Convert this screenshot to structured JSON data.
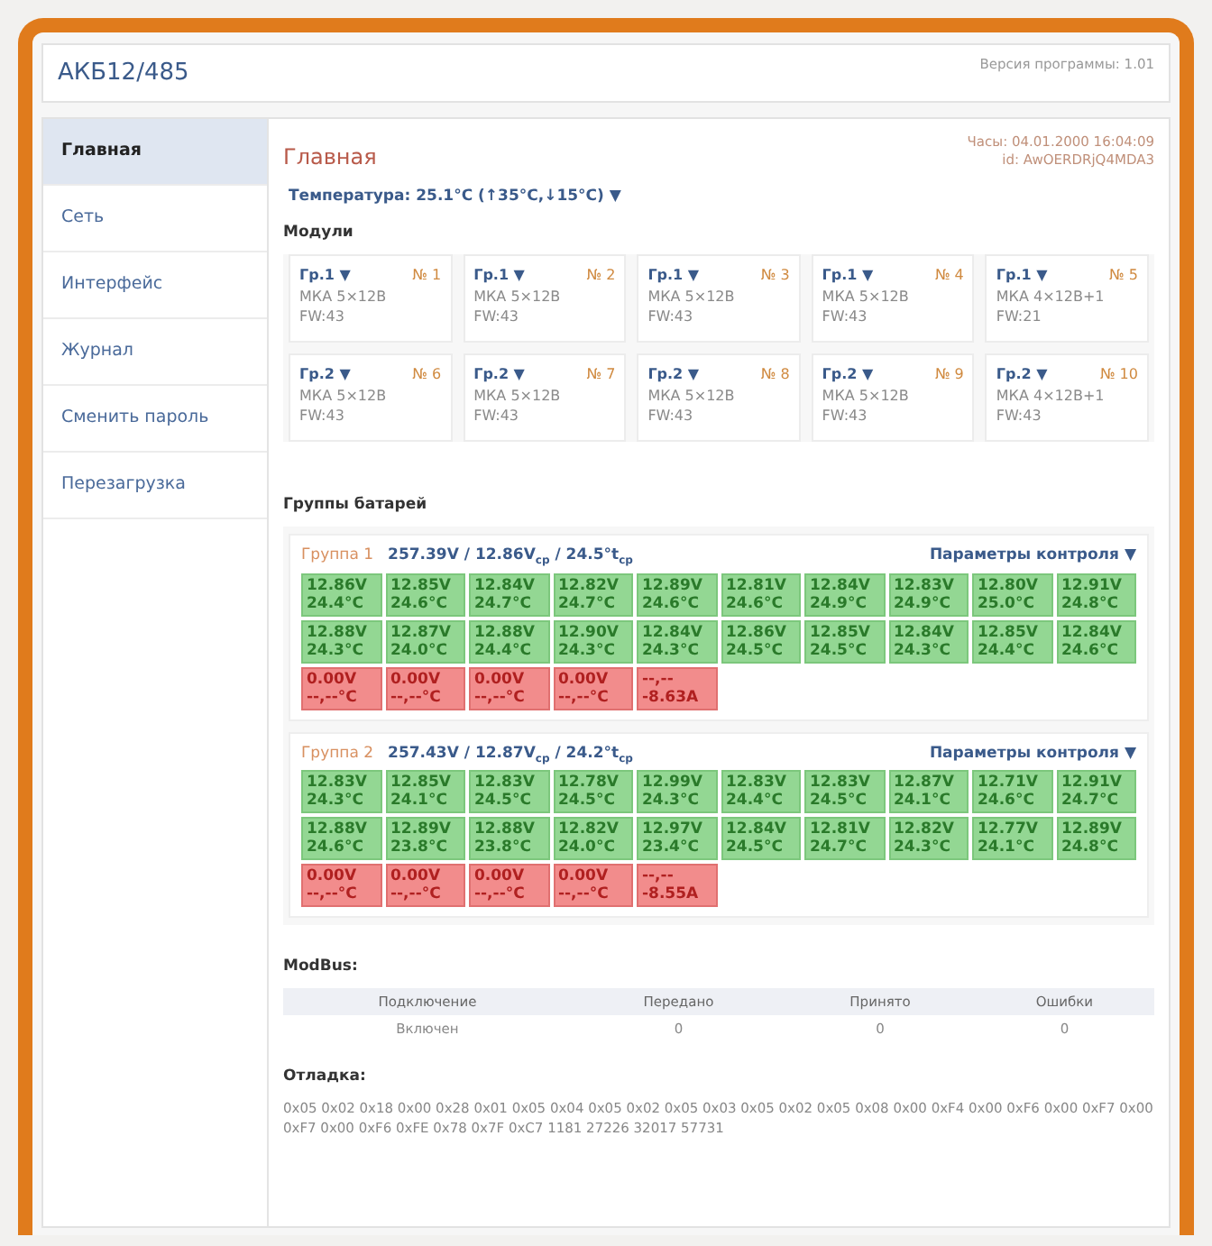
{
  "header": {
    "title": "АКБ12/485",
    "version": "Версия программы: 1.01"
  },
  "sidebar": {
    "items": [
      {
        "label": "Главная",
        "selected": true
      },
      {
        "label": "Сеть",
        "selected": false
      },
      {
        "label": "Интерфейс",
        "selected": false
      },
      {
        "label": "Журнал",
        "selected": false
      },
      {
        "label": "Сменить пароль",
        "selected": false
      },
      {
        "label": "Перезагрузка",
        "selected": false
      }
    ]
  },
  "main": {
    "title": "Главная",
    "clock": "Часы: 04.01.2000 16:04:09",
    "id": "id: AwOERDRjQ4MDA3",
    "temperature": "Температура: 25.1°C (↑35°C,↓15°C) ▼",
    "modules_title": "Модули",
    "modules": [
      {
        "group": "Гр.1 ▼",
        "number": "№ 1",
        "type": "МКА 5×12В",
        "fw": "FW:43"
      },
      {
        "group": "Гр.1 ▼",
        "number": "№ 2",
        "type": "МКА 5×12В",
        "fw": "FW:43"
      },
      {
        "group": "Гр.1 ▼",
        "number": "№ 3",
        "type": "МКА 5×12В",
        "fw": "FW:43"
      },
      {
        "group": "Гр.1 ▼",
        "number": "№ 4",
        "type": "МКА 5×12В",
        "fw": "FW:43"
      },
      {
        "group": "Гр.1 ▼",
        "number": "№ 5",
        "type": "МКА 4×12В+1",
        "fw": "FW:21"
      },
      {
        "group": "Гр.2 ▼",
        "number": "№ 6",
        "type": "МКА 5×12В",
        "fw": "FW:43"
      },
      {
        "group": "Гр.2 ▼",
        "number": "№ 7",
        "type": "МКА 5×12В",
        "fw": "FW:43"
      },
      {
        "group": "Гр.2 ▼",
        "number": "№ 8",
        "type": "МКА 5×12В",
        "fw": "FW:43"
      },
      {
        "group": "Гр.2 ▼",
        "number": "№ 9",
        "type": "МКА 5×12В",
        "fw": "FW:43"
      },
      {
        "group": "Гр.2 ▼",
        "number": "№ 10",
        "type": "МКА 4×12В+1",
        "fw": "FW:43"
      }
    ],
    "groups_title": "Группы батарей",
    "groups": [
      {
        "name": "Группа 1",
        "summary": "257.39V / 12.86V$_{ср}$ / 24.5°t$_{ср}$",
        "control": "Параметры контроля ▼",
        "cells": [
          {
            "kind": "ok",
            "top": "12.86V",
            "bottom": "24.4°C"
          },
          {
            "kind": "ok",
            "top": "12.85V",
            "bottom": "24.6°C"
          },
          {
            "kind": "ok",
            "top": "12.84V",
            "bottom": "24.7°C"
          },
          {
            "kind": "ok",
            "top": "12.82V",
            "bottom": "24.7°C"
          },
          {
            "kind": "ok",
            "top": "12.89V",
            "bottom": "24.6°C"
          },
          {
            "kind": "ok",
            "top": "12.81V",
            "bottom": "24.6°C"
          },
          {
            "kind": "ok",
            "top": "12.84V",
            "bottom": "24.9°C"
          },
          {
            "kind": "ok",
            "top": "12.83V",
            "bottom": "24.9°C"
          },
          {
            "kind": "ok",
            "top": "12.80V",
            "bottom": "25.0°C"
          },
          {
            "kind": "ok",
            "top": "12.91V",
            "bottom": "24.8°C"
          },
          {
            "kind": "ok",
            "top": "12.88V",
            "bottom": "24.3°C"
          },
          {
            "kind": "ok",
            "top": "12.87V",
            "bottom": "24.0°C"
          },
          {
            "kind": "ok",
            "top": "12.88V",
            "bottom": "24.4°C"
          },
          {
            "kind": "ok",
            "top": "12.90V",
            "bottom": "24.3°C"
          },
          {
            "kind": "ok",
            "top": "12.84V",
            "bottom": "24.3°C"
          },
          {
            "kind": "ok",
            "top": "12.86V",
            "bottom": "24.5°C"
          },
          {
            "kind": "ok",
            "top": "12.85V",
            "bottom": "24.5°C"
          },
          {
            "kind": "ok",
            "top": "12.84V",
            "bottom": "24.3°C"
          },
          {
            "kind": "ok",
            "top": "12.85V",
            "bottom": "24.4°C"
          },
          {
            "kind": "ok",
            "top": "12.84V",
            "bottom": "24.6°C"
          },
          {
            "kind": "fault",
            "top": "0.00V",
            "bottom": "--,--°C"
          },
          {
            "kind": "fault",
            "top": "0.00V",
            "bottom": "--,--°C"
          },
          {
            "kind": "fault",
            "top": "0.00V",
            "bottom": "--,--°C"
          },
          {
            "kind": "fault",
            "top": "0.00V",
            "bottom": "--,--°C"
          },
          {
            "kind": "fault",
            "top": "--,--",
            "bottom": "-8.63A"
          }
        ]
      },
      {
        "name": "Группа 2",
        "summary": "257.43V / 12.87V$_{ср}$ / 24.2°t$_{ср}$",
        "control": "Параметры контроля ▼",
        "cells": [
          {
            "kind": "ok",
            "top": "12.83V",
            "bottom": "24.3°C"
          },
          {
            "kind": "ok",
            "top": "12.85V",
            "bottom": "24.1°C"
          },
          {
            "kind": "ok",
            "top": "12.83V",
            "bottom": "24.5°C"
          },
          {
            "kind": "ok",
            "top": "12.78V",
            "bottom": "24.5°C"
          },
          {
            "kind": "ok",
            "top": "12.99V",
            "bottom": "24.3°C"
          },
          {
            "kind": "ok",
            "top": "12.83V",
            "bottom": "24.4°C"
          },
          {
            "kind": "ok",
            "top": "12.83V",
            "bottom": "24.5°C"
          },
          {
            "kind": "ok",
            "top": "12.87V",
            "bottom": "24.1°C"
          },
          {
            "kind": "ok",
            "top": "12.71V",
            "bottom": "24.6°C"
          },
          {
            "kind": "ok",
            "top": "12.91V",
            "bottom": "24.7°C"
          },
          {
            "kind": "ok",
            "top": "12.88V",
            "bottom": "24.6°C"
          },
          {
            "kind": "ok",
            "top": "12.89V",
            "bottom": "23.8°C"
          },
          {
            "kind": "ok",
            "top": "12.88V",
            "bottom": "23.8°C"
          },
          {
            "kind": "ok",
            "top": "12.82V",
            "bottom": "24.0°C"
          },
          {
            "kind": "ok",
            "top": "12.97V",
            "bottom": "23.4°C"
          },
          {
            "kind": "ok",
            "top": "12.84V",
            "bottom": "24.5°C"
          },
          {
            "kind": "ok",
            "top": "12.81V",
            "bottom": "24.7°C"
          },
          {
            "kind": "ok",
            "top": "12.82V",
            "bottom": "24.3°C"
          },
          {
            "kind": "ok",
            "top": "12.77V",
            "bottom": "24.1°C"
          },
          {
            "kind": "ok",
            "top": "12.89V",
            "bottom": "24.8°C"
          },
          {
            "kind": "fault",
            "top": "0.00V",
            "bottom": "--,--°C"
          },
          {
            "kind": "fault",
            "top": "0.00V",
            "bottom": "--,--°C"
          },
          {
            "kind": "fault",
            "top": "0.00V",
            "bottom": "--,--°C"
          },
          {
            "kind": "fault",
            "top": "0.00V",
            "bottom": "--,--°C"
          },
          {
            "kind": "fault",
            "top": "--,--",
            "bottom": "-8.55A"
          }
        ]
      }
    ],
    "modbus": {
      "title": "ModBus:",
      "columns": [
        "Подключение",
        "Передано",
        "Принято",
        "Ошибки"
      ],
      "rows": [
        [
          "Включен",
          "0",
          "0",
          "0"
        ]
      ]
    },
    "debug": {
      "title": "Отладка:",
      "text": "0x05 0x02 0x18 0x00 0x28 0x01 0x05 0x04 0x05 0x02 0x05 0x03 0x05 0x02 0x05 0x08 0x00 0xF4 0x00 0xF6 0x00 0xF7 0x00 0xF7 0x00 0xF6 0xFE 0x78 0x7F 0xC7 1181 27226 32017 57731"
    }
  }
}
